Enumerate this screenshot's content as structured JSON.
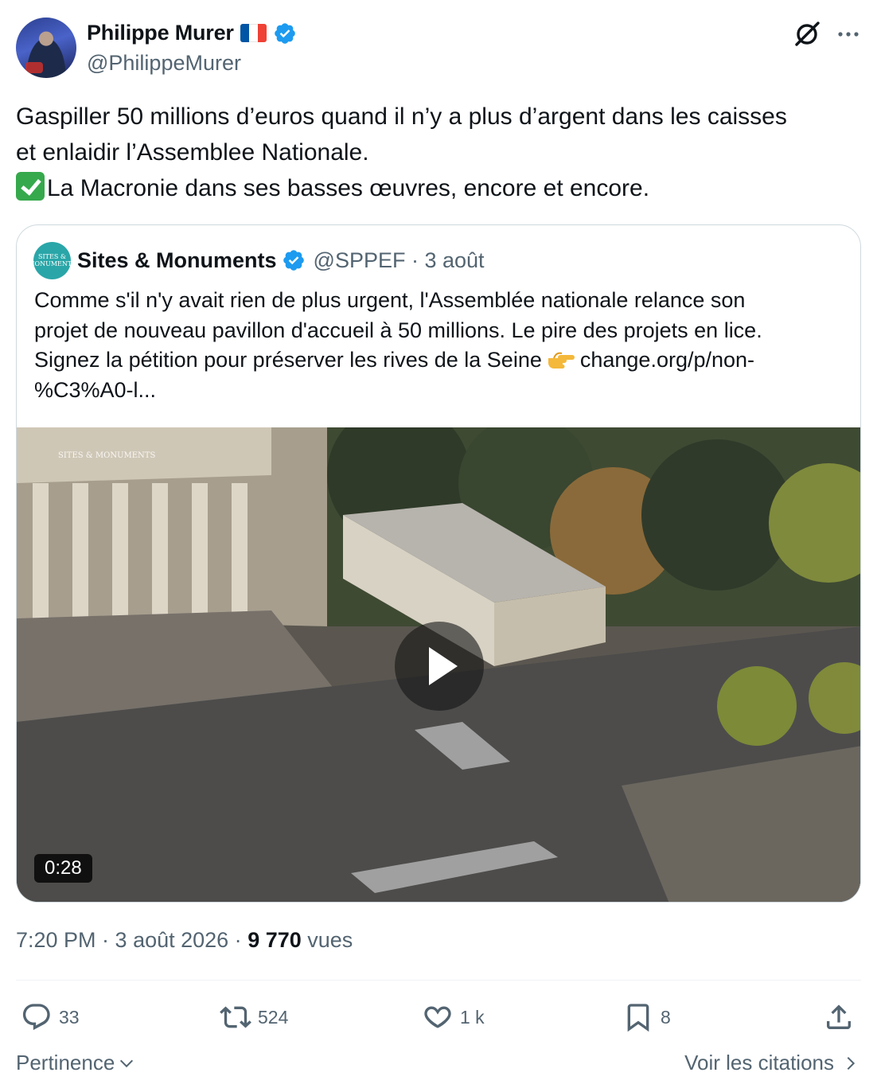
{
  "author": {
    "name": "Philippe Murer",
    "handle": "@PhilippeMurer",
    "flag_colors": [
      "#0055a4",
      "#ffffff",
      "#ef4135"
    ],
    "verified_color": "#1d9bf0"
  },
  "tweet": {
    "lines": [
      "Gaspiller 50 millions d’euros quand il n’y a plus d’argent dans les caisses",
      "et enlaidir l’Assemblee Nationale.",
      "La Macronie dans ses basses œuvres, encore et encore."
    ],
    "line3_emoji": "check-mark-icon"
  },
  "quote": {
    "avatar_text": "SITES & MONUMENTS",
    "name": "Sites & Monuments",
    "handle_date": "@SPPEF · 3 août",
    "lines": [
      "Comme s'il n'y avait rien de plus urgent, l'Assemblée nationale relance son",
      "projet de nouveau pavillon d'accueil à 50 millions. Le pire des projets en lice.",
      "Signez la pétition pour préserver les rives de la Seine",
      "change.org/p/non-",
      "%C3%A0-l..."
    ],
    "video": {
      "duration": "0:28",
      "watermark": "SITES & MONUMENTS"
    }
  },
  "meta": {
    "time": "7:20 PM · 3 août 2026 · ",
    "views": "9 770",
    "views_label": " vues"
  },
  "actions": {
    "replies": "33",
    "reposts": "524",
    "likes": "1 k",
    "bookmarks": "8"
  },
  "footer": {
    "sort_label": "Pertinence",
    "quotes_label": "Voir les citations"
  },
  "colors": {
    "text": "#0f1419",
    "secondary": "#536471",
    "border": "#cfd9de",
    "accent": "#1d9bf0"
  }
}
